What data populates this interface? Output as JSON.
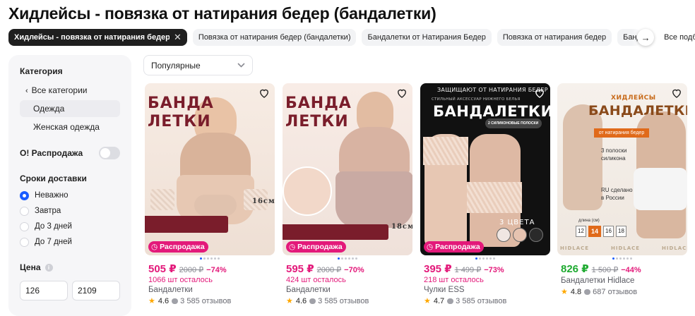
{
  "page": {
    "title": "Хидлейсы - повязка от натирания бедер (бандалетки)"
  },
  "chips": {
    "active": "Хидлейсы - повязка от натирания бедер (бандалетки)",
    "items": [
      "Повязка от натирания бедер (бандалетки)",
      "Бандалетки от Натирания Бедер",
      "Повязка от натирания бедер",
      "Банда"
    ],
    "all": "Все подборки"
  },
  "sidebar": {
    "category_heading": "Категория",
    "categories": [
      "Все категории",
      "Одежда",
      "Женская одежда"
    ],
    "sale_toggle": "О! Распродажа",
    "delivery_heading": "Сроки доставки",
    "delivery_options": [
      "Неважно",
      "Завтра",
      "До 3 дней",
      "До 7 дней"
    ],
    "price_heading": "Цена",
    "price_info": "i",
    "price_from": "126",
    "price_to": "2109"
  },
  "sort": {
    "value": "Популярные"
  },
  "badge_label": "Распродажа",
  "products": [
    {
      "price": "505 ₽",
      "old": "2000 ₽",
      "discount": "−74%",
      "left": "1066 шт осталось",
      "name": "Бандалетки",
      "rating": "4.6",
      "reviews": "3 585 отзывов",
      "img_title": "БАНДА\nЛЕТКИ",
      "img_note": "16см",
      "price_color": "pink"
    },
    {
      "price": "595 ₽",
      "old": "2000 ₽",
      "discount": "−70%",
      "left": "424 шт осталось",
      "name": "Бандалетки",
      "rating": "4.6",
      "reviews": "3 585 отзывов",
      "img_title": "БАНДА\nЛЕТКИ",
      "img_note": "18см",
      "price_color": "pink"
    },
    {
      "price": "395 ₽",
      "old": "1 499 ₽",
      "discount": "−73%",
      "left": "218 шт осталось",
      "name": "Чулки ESS",
      "rating": "4.7",
      "reviews": "3 585 отзывов",
      "img_top": "ЗАЩИЩАЮТ ОТ НАТИРАНИЯ БЕДЕР",
      "img_sub": "СТИЛЬНЫЙ АКСЕССУАР НИЖНЕГО БЕЛЬЯ",
      "img_title": "БАНДАЛЕТКИ",
      "img_note": "3 ЦВЕТА",
      "img_badge": "2 СИЛИКОНОВЫЕ ПОЛОСКИ",
      "price_color": "pink"
    },
    {
      "price": "826 ₽",
      "old": "1 500 ₽",
      "discount": "−44%",
      "left": "",
      "name": "Бандалетки Hidlace",
      "rating": "4.8",
      "reviews": "687 отзывов",
      "img_brand": "ХИДЛЕЙСЫ",
      "img_title": "БАНДАЛЕТКИ",
      "img_sub": "от натирания бедер",
      "img_f1": "3 полоски силикона",
      "img_f2": "RU сделано в России",
      "img_sizes_label": "длина (см)",
      "img_sizes": [
        "12",
        "14",
        "16",
        "18"
      ],
      "img_wm": "HIDLACE",
      "price_color": "green"
    }
  ],
  "colors": {
    "accent_pink": "#e3197a",
    "accent_blue": "#1a5cff",
    "price_green": "#1eaa30"
  }
}
